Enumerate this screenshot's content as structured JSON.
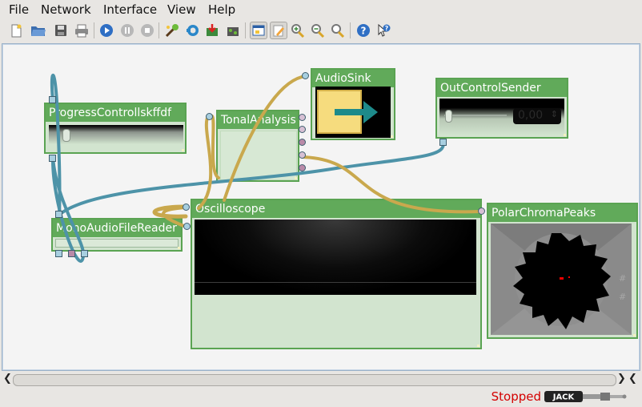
{
  "menu": [
    "File",
    "Network",
    "Interface",
    "View",
    "Help"
  ],
  "toolbar_icons": [
    "new-file-icon",
    "open-folder-icon",
    "save-icon",
    "print-icon",
    "play-icon",
    "pause-icon",
    "stop-icon",
    "add-processor-icon",
    "refresh-icon",
    "import-icon",
    "export-icon",
    "show-interface-icon",
    "edit-mode-icon",
    "zoom-in-icon",
    "zoom-out-icon",
    "zoom-fit-icon",
    "help-icon",
    "whats-this-icon"
  ],
  "nodes": {
    "progress_control": {
      "title": "ProgressControllskffdf"
    },
    "tonal_analysis": {
      "title": "TonalAnalysis"
    },
    "audio_sink": {
      "title": "AudioSink"
    },
    "out_control_sender": {
      "title": "OutControlSender",
      "value": "0,00"
    },
    "mono_audio_file_reader": {
      "title": "MonoAudioFileReader"
    },
    "oscilloscope": {
      "title": "Oscilloscope"
    },
    "polar_chroma_peaks": {
      "title": "PolarChromaPeaks",
      "labels": [
        "#",
        "#"
      ]
    }
  },
  "status": {
    "text": "Stopped",
    "jack_label": "JACK"
  },
  "colors": {
    "node_title": "#61aa5a",
    "node_body": "#d2e4cf",
    "wire_audio": "#c9a84d",
    "wire_control": "#4d93a8",
    "status": "#d40000"
  }
}
